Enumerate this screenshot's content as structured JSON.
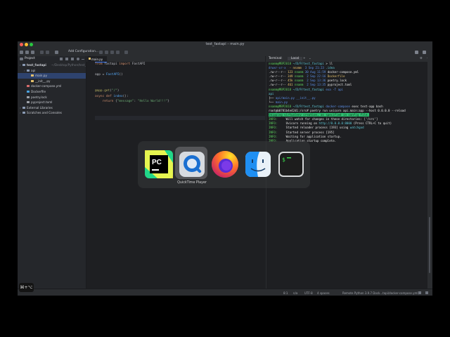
{
  "window": {
    "title": "test_fastapi – main.py"
  },
  "toolbar": {
    "add_config": "Add Configuration..."
  },
  "project": {
    "title": "Project",
    "tree": [
      {
        "label": "test_fastapi",
        "suffix": "~/Desktop/Python/test_fastapi",
        "indent": 0,
        "icon": "folder",
        "bold": true
      },
      {
        "label": "api",
        "suffix": "",
        "indent": 1,
        "icon": "folder"
      },
      {
        "label": "main.py",
        "suffix": "",
        "indent": 2,
        "icon": "python-file",
        "selected": true
      },
      {
        "label": "__init__.py",
        "suffix": "",
        "indent": 2,
        "icon": "python-file"
      },
      {
        "label": "docker-compose.yml",
        "suffix": "",
        "indent": 1,
        "icon": "yaml-file"
      },
      {
        "label": "Dockerfile",
        "suffix": "",
        "indent": 1,
        "icon": "docker-file"
      },
      {
        "label": "poetry.lock",
        "suffix": "",
        "indent": 1,
        "icon": "text-file"
      },
      {
        "label": "pyproject.toml",
        "suffix": "",
        "indent": 1,
        "icon": "toml-file"
      },
      {
        "label": "External Libraries",
        "suffix": "",
        "indent": 0,
        "icon": "library"
      },
      {
        "label": "Scratches and Consoles",
        "suffix": "",
        "indent": 0,
        "icon": "scratch"
      }
    ]
  },
  "editor": {
    "tab": "main.py",
    "code": [
      [
        [
          "kw",
          "from "
        ],
        [
          "",
          "fastapi "
        ],
        [
          "kw",
          "import "
        ],
        [
          "",
          "FastAPI"
        ]
      ],
      [],
      [
        [
          "",
          "app = "
        ],
        [
          "fn",
          "FastAPI"
        ],
        [
          "",
          "()"
        ]
      ],
      [],
      [],
      [
        [
          "dc",
          "@app.get"
        ],
        [
          "",
          "("
        ],
        [
          "st",
          "\"/\""
        ],
        [
          "",
          ")"
        ]
      ],
      [
        [
          "kw",
          "async def "
        ],
        [
          "fn",
          "index"
        ],
        [
          "",
          "():"
        ]
      ],
      [
        [
          "",
          "    "
        ],
        [
          "kw",
          "return "
        ],
        [
          "",
          "{"
        ],
        [
          "st",
          "\"message\""
        ],
        [
          "",
          ": "
        ],
        [
          "st",
          "\"Hello World!!!\""
        ],
        [
          "",
          "}"
        ]
      ]
    ]
  },
  "terminal": {
    "tab_label": "Terminal:",
    "tab_name": "Local",
    "lines": [
      [
        [
          "g",
          "nnamm@MBP2018 "
        ],
        [
          "cy",
          "~/D/P/test_fastapi "
        ],
        [
          "wt",
          "> ll"
        ]
      ],
      [
        [
          "bl",
          "drwxr-xr-x  "
        ],
        [
          "yl",
          "- nnamm  "
        ],
        [
          "bl",
          "3 Sep 21:23 "
        ],
        [
          "cy",
          ".idea"
        ]
      ],
      [
        [
          "wt",
          ".rw-r--r-- "
        ],
        [
          "yl",
          "123 "
        ],
        [
          "g",
          "nnamm "
        ],
        [
          "bl",
          "30 Aug 11:59 "
        ],
        [
          "wt",
          "docker-compose.yml"
        ]
      ],
      [
        [
          "wt",
          ".rw-r--r-- "
        ],
        [
          "yl",
          "349 "
        ],
        [
          "g",
          "nnamm  "
        ],
        [
          "bl",
          "2 Sep 22:16 "
        ],
        [
          "yl",
          "Dockerfile"
        ]
      ],
      [
        [
          "wt",
          ".rw-r--r-- "
        ],
        [
          "yl",
          "45k "
        ],
        [
          "g",
          "nnamm  "
        ],
        [
          "bl",
          "2 Sep 13:36 "
        ],
        [
          "wt",
          "poetry.lock"
        ]
      ],
      [
        [
          "wt",
          ".rw-r--r-- "
        ],
        [
          "yl",
          "461 "
        ],
        [
          "g",
          "nnamm  "
        ],
        [
          "bl",
          "2 Sep 13:35 "
        ],
        [
          "wt",
          "pyproject.toml"
        ]
      ],
      [
        [
          "g",
          "nnamm@MBP2018 "
        ],
        [
          "cy",
          "~/D/P/test_fastapi "
        ],
        [
          "bl",
          "exa -T api"
        ]
      ],
      [
        [
          "cy",
          "api"
        ]
      ],
      [
        [
          "wt",
          "├── "
        ],
        [
          "bl",
          "api/main.py __init__.py"
        ]
      ],
      [
        [
          "wt",
          "└── "
        ],
        [
          "bl",
          "main.py"
        ]
      ],
      [
        [
          "g",
          "nnamm@MBP2018 "
        ],
        [
          "cy",
          "~/D/P/test_fastapi "
        ],
        [
          "bl",
          "docker-compose "
        ],
        [
          "wt",
          "exec test-app bash"
        ]
      ],
      [
        [
          "wt",
          "root@b0781b4e42d1:/src# poetry run uvicorn api.main:app --host 0.0.0.0 --reload"
        ]
      ],
      [
        [
          "hl",
          "Skipping virtualenv creation, as specified in config file."
        ]
      ],
      [
        [
          "g",
          "INFO:     "
        ],
        [
          "wt",
          "Will watch for changes in these directories: ['/src']"
        ]
      ],
      [
        [
          "g",
          "INFO:     "
        ],
        [
          "wt",
          "Uvicorn running on "
        ],
        [
          "cy",
          "http://0.0.0.0:8000"
        ],
        [
          "wt",
          " (Press CTRL+C to quit)"
        ]
      ],
      [
        [
          "g",
          "INFO:     "
        ],
        [
          "wt",
          "Started reloader process [193] using "
        ],
        [
          "cy",
          "watchgod"
        ]
      ],
      [
        [
          "g",
          "INFO:     "
        ],
        [
          "wt",
          "Started server process [195]"
        ]
      ],
      [
        [
          "g",
          "INFO:     "
        ],
        [
          "wt",
          "Waiting for application startup."
        ]
      ],
      [
        [
          "g",
          "INFO:     "
        ],
        [
          "wt",
          "Application startup complete."
        ]
      ]
    ]
  },
  "status": {
    "encoding_info": "n/a",
    "pos": "8:1",
    "enc": "UTF-8",
    "indent": "4 spaces",
    "interpreter": "Remote Python 3.9.7 Dock...tapi/docker-compose.yml)"
  },
  "switcher": {
    "apps": [
      "PyCharm",
      "QuickTime Player",
      "Firefox",
      "Finder",
      "Terminal"
    ],
    "selected_label": "QuickTime Player"
  },
  "hud": {
    "label": "⌘+⌥"
  },
  "colors": {
    "accent": "#3574f0",
    "bg": "#1e1f22",
    "panel": "#2b2d30"
  }
}
